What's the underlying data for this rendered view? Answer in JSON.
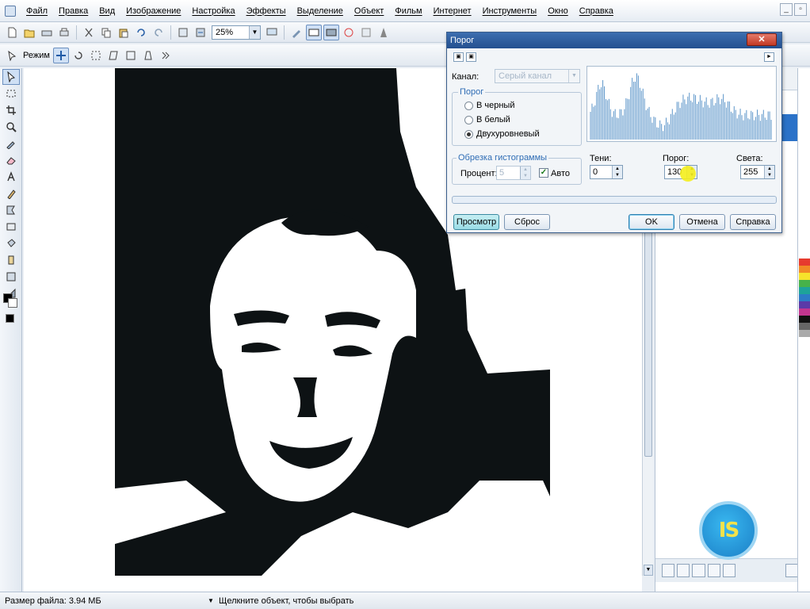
{
  "menu": [
    "Файл",
    "Правка",
    "Вид",
    "Изображение",
    "Настройка",
    "Эффекты",
    "Выделение",
    "Объект",
    "Фильм",
    "Интернет",
    "Инструменты",
    "Окно",
    "Справка"
  ],
  "toolbar": {
    "zoom": "25%",
    "mode_label": "Режим"
  },
  "dialog": {
    "title": "Порог",
    "channel_label": "Канал:",
    "channel_value": "Серый канал",
    "threshold_group": "Порог",
    "radio_black": "В черный",
    "radio_white": "В белый",
    "radio_two": "Двухуровневый",
    "clip_group": "Обрезка гистограммы",
    "percent_label": "Процент:",
    "percent_value": "5",
    "auto_label": "Авто",
    "shadows_label": "Тени:",
    "shadows_value": "0",
    "threshold_label": "Порог:",
    "threshold_value": "130",
    "highlights_label": "Света:",
    "highlights_value": "255",
    "btn_preview": "Просмотр",
    "btn_reset": "Сброс",
    "btn_ok": "OK",
    "btn_cancel": "Отмена",
    "btn_help": "Справка",
    "selected_mode": "Двухуровневый",
    "auto_checked": true
  },
  "status": {
    "file_size": "Размер файла: 3.94 МБ",
    "hint": "Щелкните объект, чтобы выбрать"
  },
  "logo_text": "IS",
  "colors": {
    "accent": "#2b72c8",
    "title_bar": "#24508f",
    "histogram": "#5c95c9"
  }
}
